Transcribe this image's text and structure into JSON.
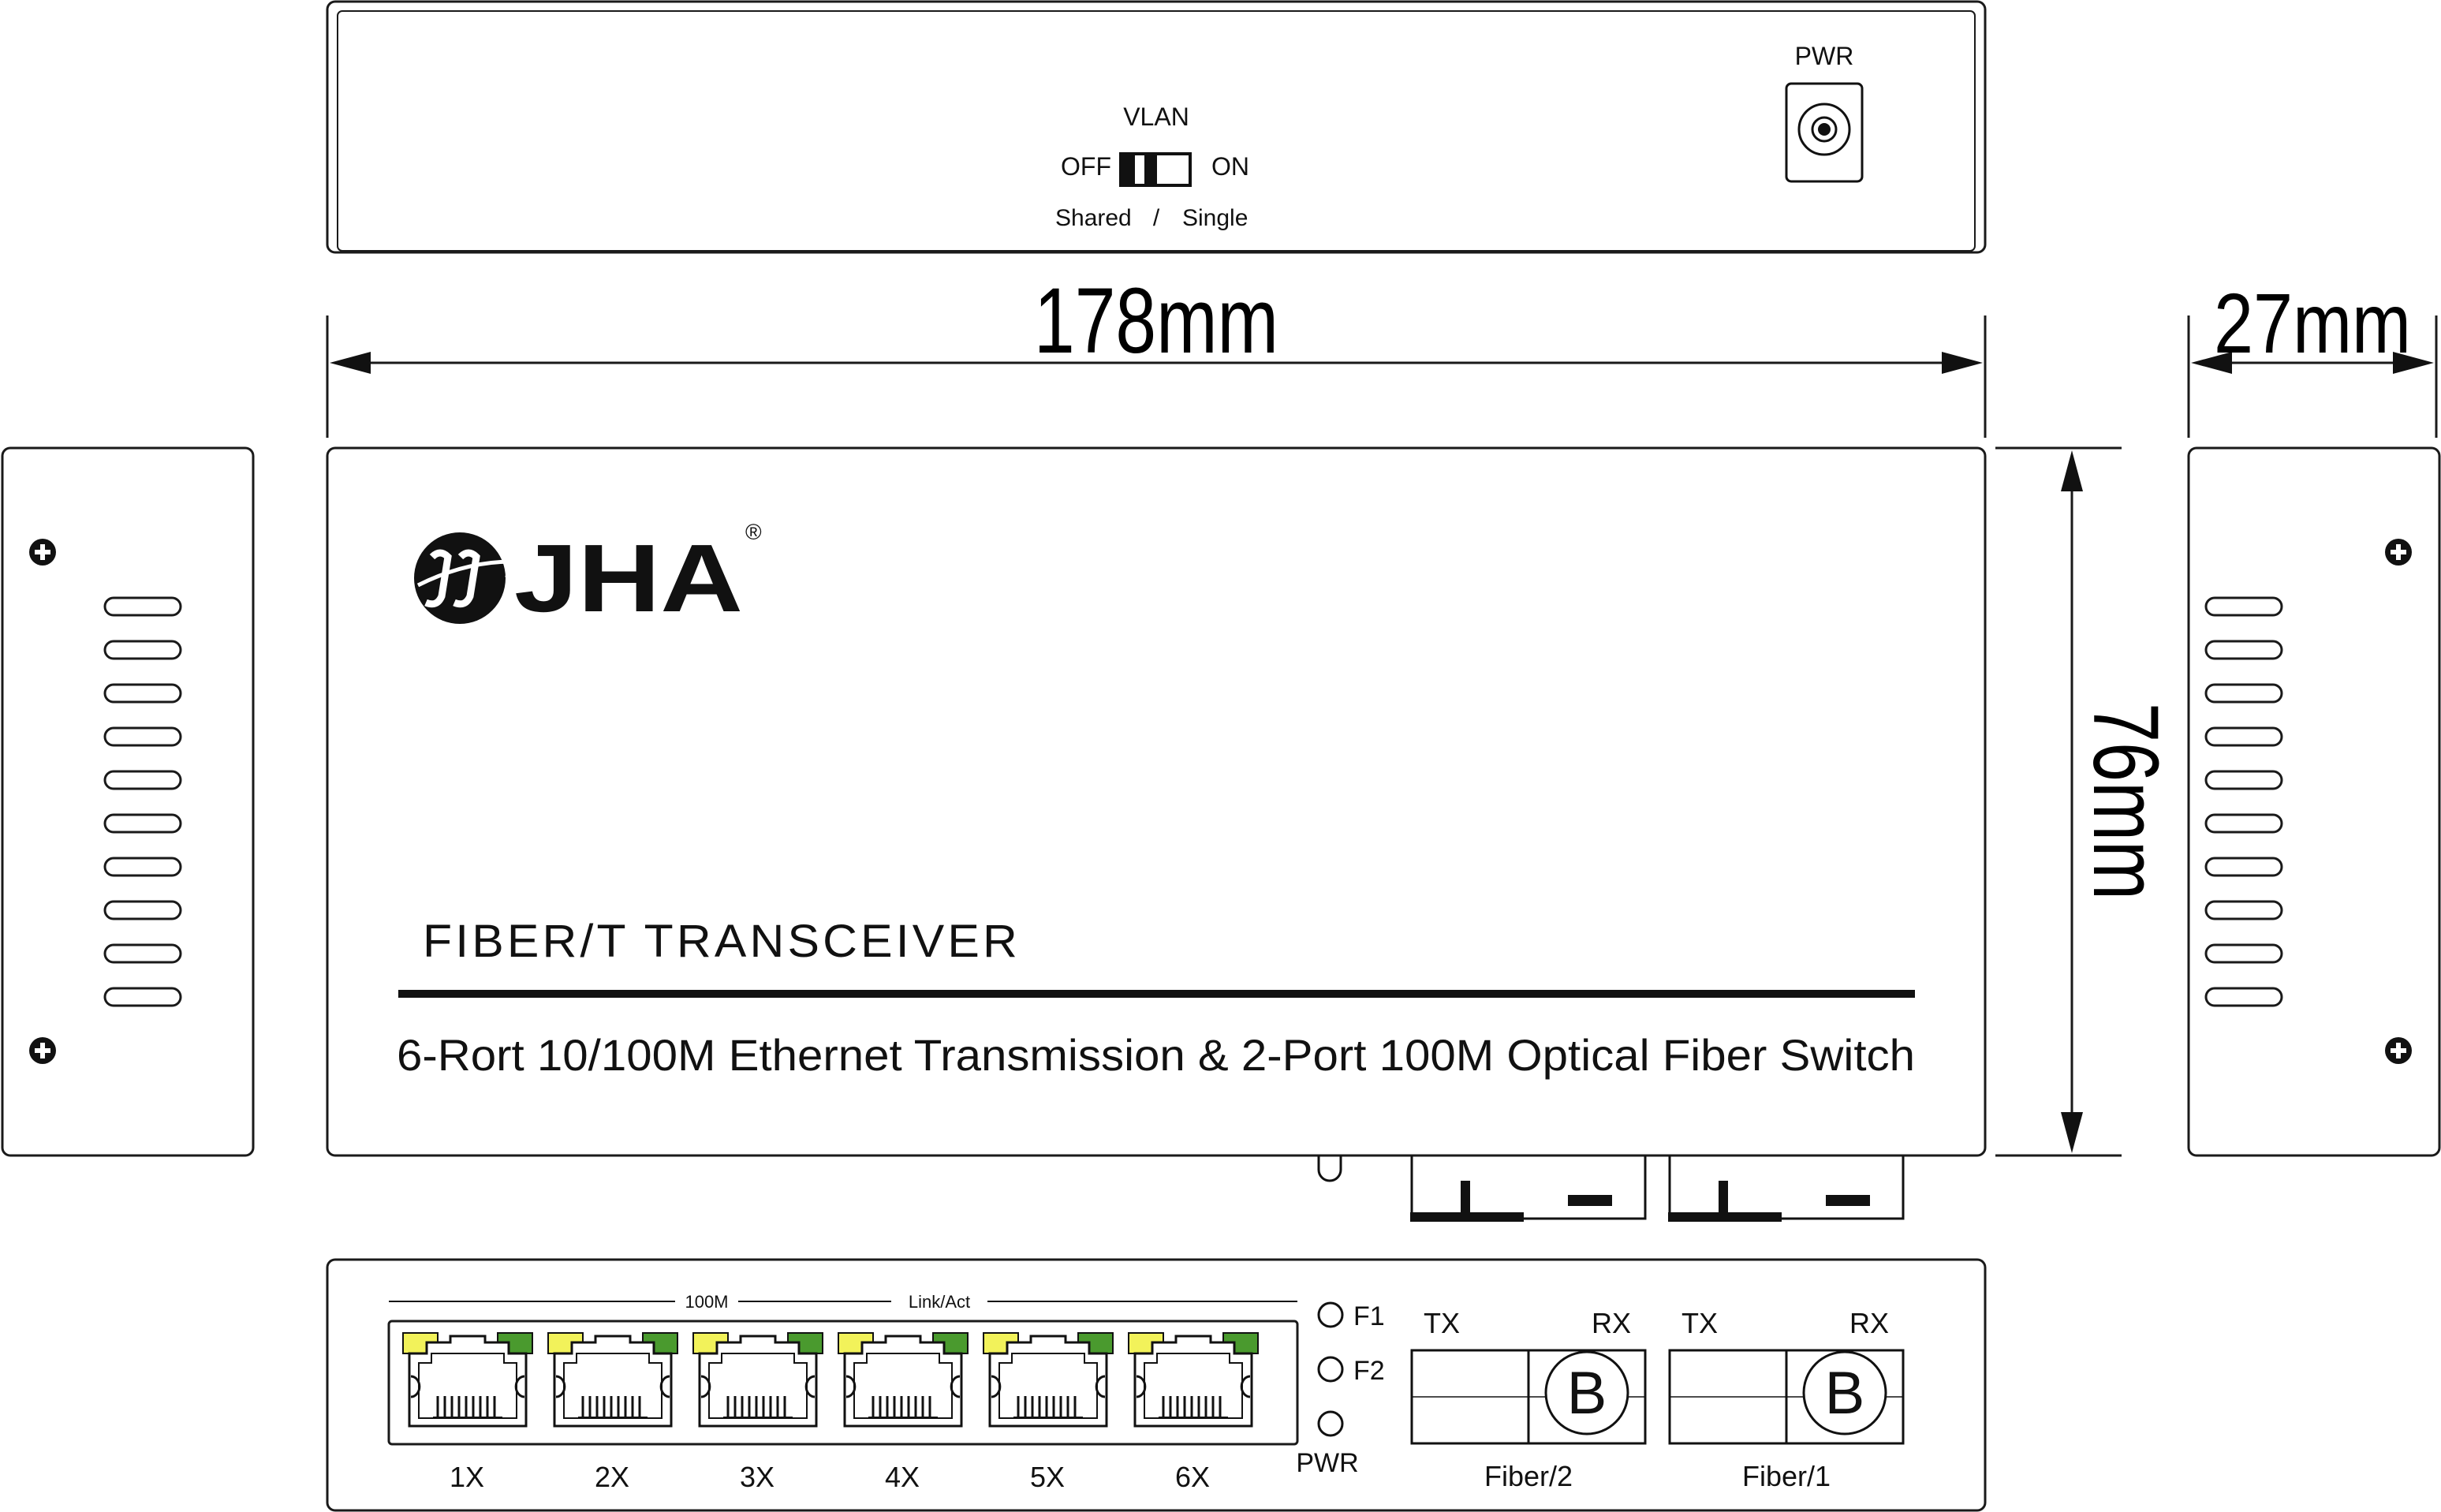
{
  "colors": {
    "line": "#1a1a1a",
    "led_yellow": "#f2f25a",
    "led_green": "#4a9a2e",
    "background": "#ffffff"
  },
  "top_view": {
    "vlan_label": "VLAN",
    "switch_off": "OFF",
    "switch_on": "ON",
    "switch_shared": "Shared",
    "switch_sep": "/",
    "switch_single": "Single",
    "pwr_label": "PWR"
  },
  "dimensions": {
    "width": "178mm",
    "depth": "27mm",
    "height": "76mm"
  },
  "front_view": {
    "brand": "JHA",
    "registered": "®",
    "product_title": "FIBER/T TRANSCEIVER",
    "product_description": "6-Rort 10/100M Ethernet Transmission & 2-Port 100M Optical Fiber Switch"
  },
  "port_panel": {
    "led_label_left": "100M",
    "led_label_right": "Link/Act",
    "ports": [
      "1X",
      "2X",
      "3X",
      "4X",
      "5X",
      "6X"
    ],
    "status_leds": [
      "F1",
      "F2",
      "PWR"
    ],
    "fiber_ports": [
      {
        "name": "Fiber/2",
        "tx": "TX",
        "rx": "RX",
        "letter": "B"
      },
      {
        "name": "Fiber/1",
        "tx": "TX",
        "rx": "RX",
        "letter": "B"
      }
    ]
  },
  "icons": [
    "jha-logo-icon",
    "screw-icon",
    "vent-slot-icon",
    "rj45-port-icon",
    "dc-jack-icon",
    "vlan-switch-icon"
  ]
}
